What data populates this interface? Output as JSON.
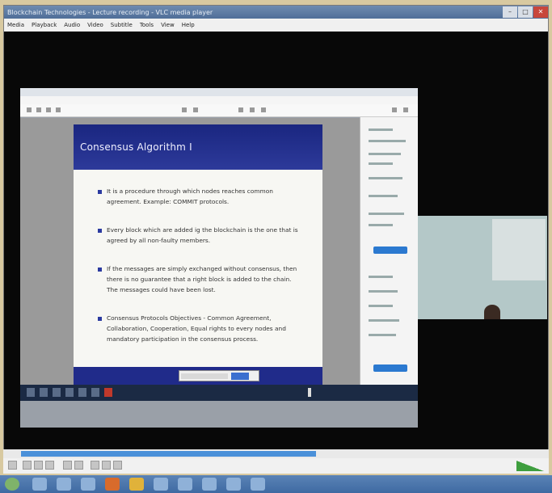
{
  "player": {
    "title": "Blockchain Technologies - Lecture recording - VLC media player",
    "menu": [
      "Media",
      "Playback",
      "Audio",
      "Video",
      "Subtitle",
      "Tools",
      "View",
      "Help"
    ]
  },
  "slide": {
    "title": "Consensus Algorithm I",
    "bullets": [
      "It is a procedure through which nodes reaches common agreement. Example: COMMIT protocols.",
      "Every block which are added ig the blockchain is the one that is agreed by all non-faulty members.",
      "If the messages are simply exchanged without consensus, then there is no guarantee that a right block is added to the chain. The messages could have been lost.",
      "Consensus Protocols Objectives - Common Agreement, Collaboration, Cooperation, Equal rights to every nodes and mandatory participation in the consensus process."
    ]
  },
  "colors": {
    "slide_header": "#1a2680",
    "slide_footer": "#202b8a",
    "seek_played": "#4a90d9",
    "taskbar": "#3f6aa2"
  },
  "playback": {
    "progress": 0.54
  }
}
